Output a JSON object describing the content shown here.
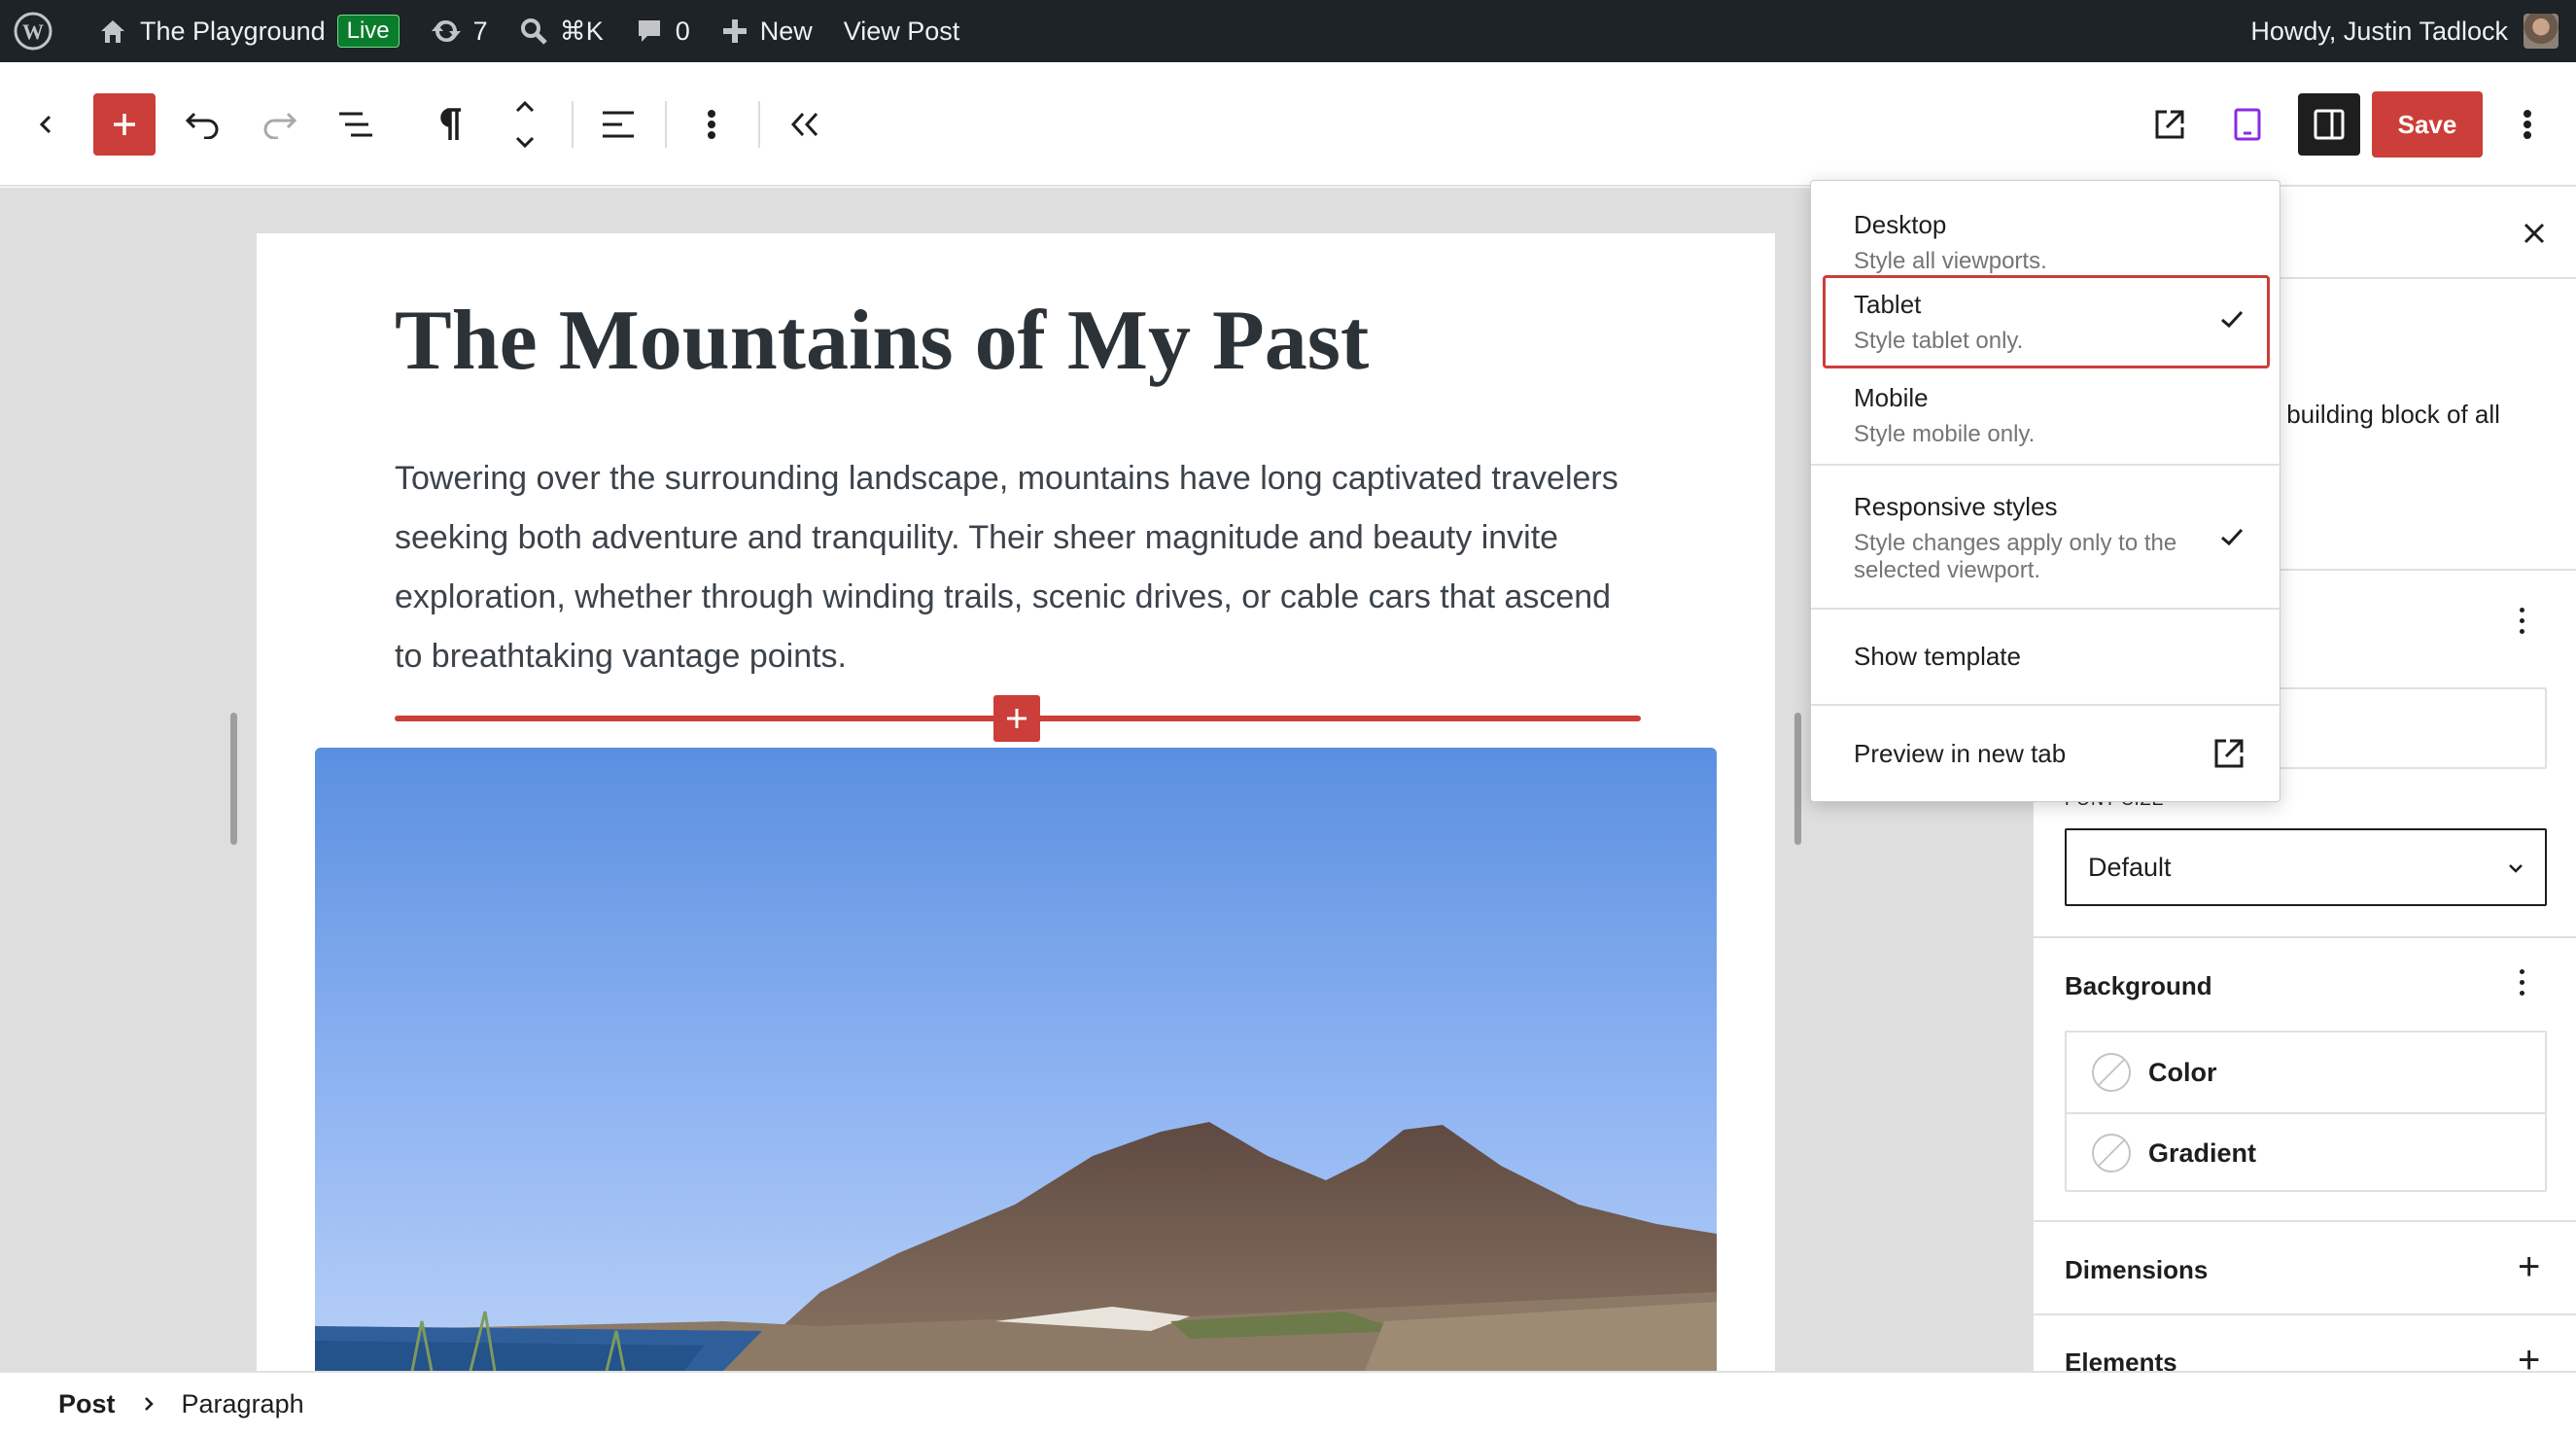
{
  "admin_bar": {
    "site_name": "The Playground",
    "live_badge": "Live",
    "updates_count": "7",
    "search_shortcut": "⌘K",
    "comments_count": "0",
    "new_label": "New",
    "view_post_label": "View Post",
    "greeting": "Howdy, Justin Tadlock"
  },
  "toolbar": {
    "save_label": "Save"
  },
  "post": {
    "title": "The Mountains of My Past",
    "paragraph": "Towering over the surrounding landscape, mountains have long captivated travelers seeking both adventure and tranquility. Their sheer magnitude and beauty invite exploration, whether through winding trails, scenic drives, or cable cars that ascend to breathtaking vantage points."
  },
  "view_menu": {
    "items": [
      {
        "label": "Desktop",
        "description": "Style all viewports."
      },
      {
        "label": "Tablet",
        "description": "Style tablet only."
      },
      {
        "label": "Mobile",
        "description": "Style mobile only."
      }
    ],
    "responsive": {
      "label": "Responsive styles",
      "description": "Style changes apply only to the selected viewport."
    },
    "show_template": "Show template",
    "preview_new_tab": "Preview in new tab"
  },
  "sidebar": {
    "partial_description": "c building block of all",
    "font_size_label": "FONT SIZE",
    "font_size_value": "Default",
    "background_heading": "Background",
    "background_items": [
      "Color",
      "Gradient"
    ],
    "dimensions_heading": "Dimensions",
    "elements_heading": "Elements"
  },
  "breadcrumb": {
    "root": "Post",
    "current": "Paragraph"
  },
  "colors": {
    "accent": "#cc3e39",
    "admin_bar": "#1d2327",
    "live_badge": "#0a7d2c",
    "canvas": "#dedede"
  }
}
